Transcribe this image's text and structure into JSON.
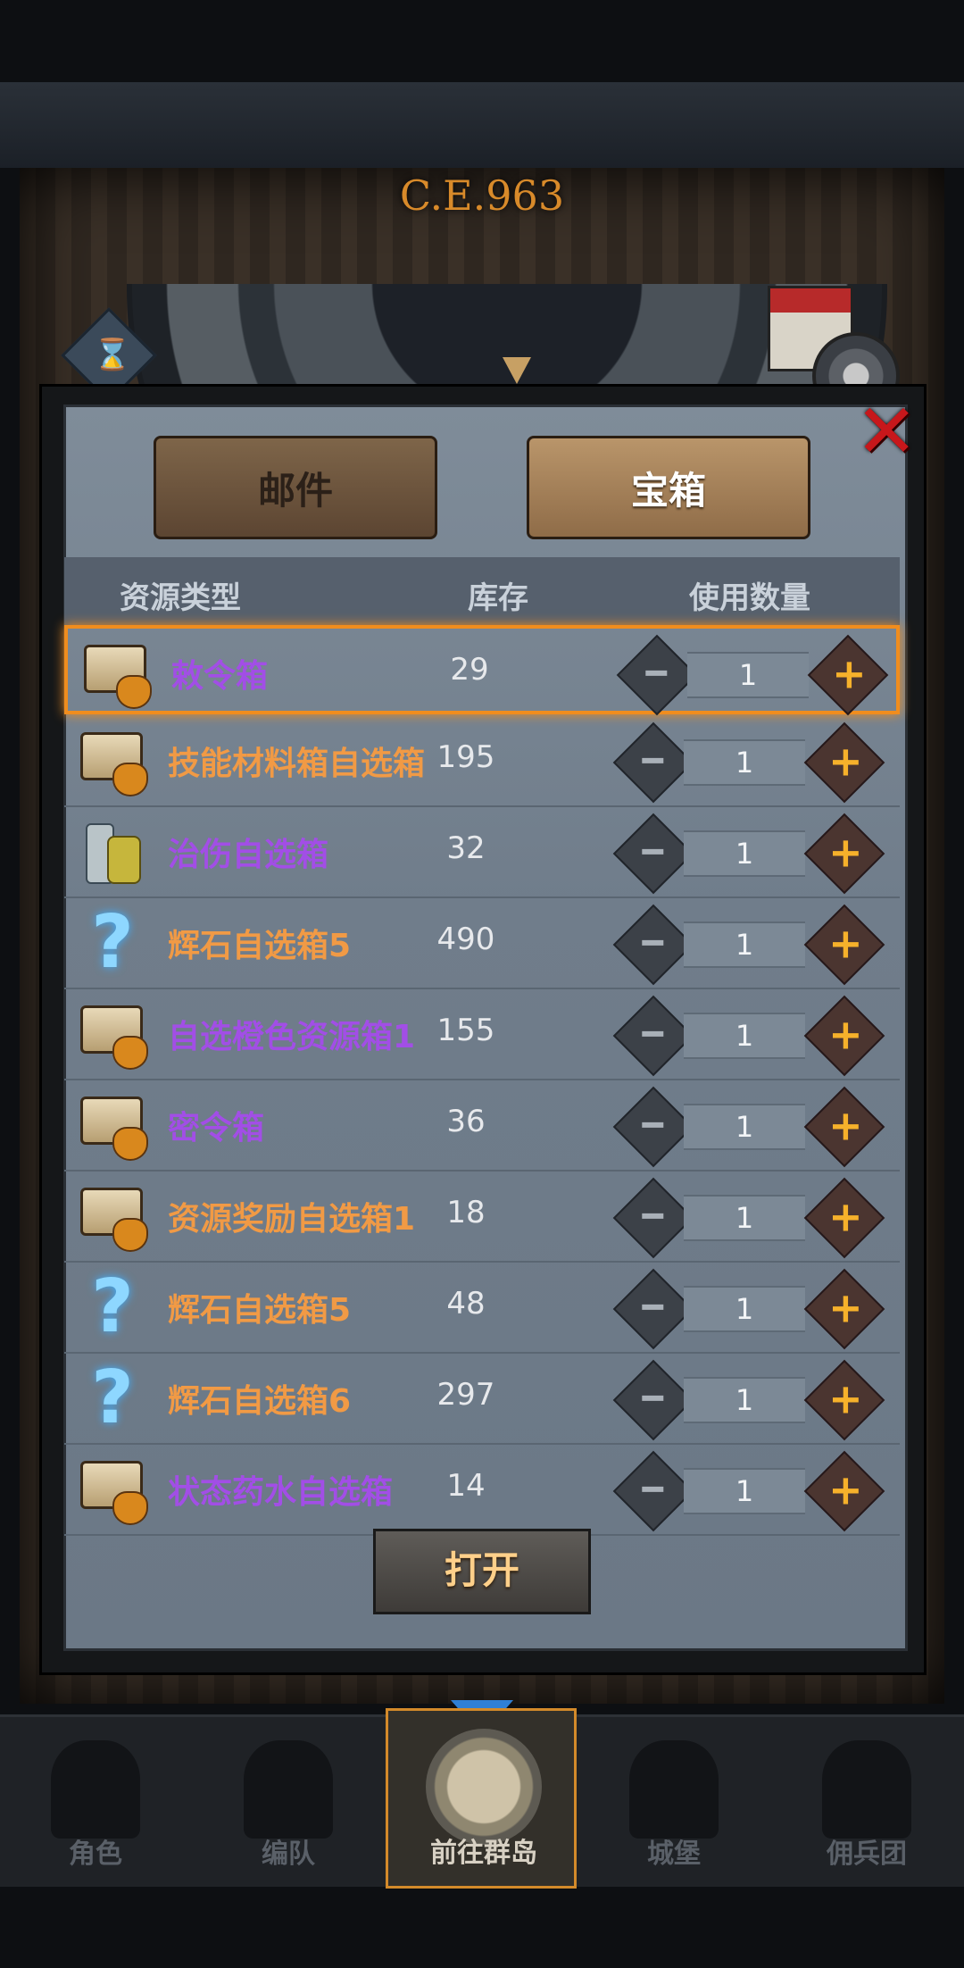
{
  "world": {
    "year": "C.E.963"
  },
  "tabs": {
    "mail": "邮件",
    "chest": "宝箱"
  },
  "header": {
    "type": "资源类型",
    "stock": "库存",
    "use": "使用数量"
  },
  "items": [
    {
      "name": "敕令箱",
      "stock": "29",
      "count": "1",
      "icon": "chest-icon",
      "color": "#a24ee6"
    },
    {
      "name": "技能材料箱自选箱",
      "stock": "195",
      "count": "1",
      "icon": "chest-icon",
      "color": "#f19a45"
    },
    {
      "name": "治伤自选箱",
      "stock": "32",
      "count": "1",
      "icon": "potion-icon",
      "color": "#a24ee6"
    },
    {
      "name": "辉石自选箱5",
      "stock": "490",
      "count": "1",
      "icon": "question-icon",
      "color": "#f19a45"
    },
    {
      "name": "自选橙色资源箱1",
      "stock": "155",
      "count": "1",
      "icon": "chest-icon",
      "color": "#a24ee6"
    },
    {
      "name": "密令箱",
      "stock": "36",
      "count": "1",
      "icon": "chest-icon",
      "color": "#a24ee6"
    },
    {
      "name": "资源奖励自选箱1",
      "stock": "18",
      "count": "1",
      "icon": "chest-icon",
      "color": "#f19a45"
    },
    {
      "name": "辉石自选箱5",
      "stock": "48",
      "count": "1",
      "icon": "question-icon",
      "color": "#f19a45"
    },
    {
      "name": "辉石自选箱6",
      "stock": "297",
      "count": "1",
      "icon": "question-icon",
      "color": "#f19a45"
    },
    {
      "name": "状态药水自选箱",
      "stock": "14",
      "count": "1",
      "icon": "chest-icon",
      "color": "#a24ee6"
    }
  ],
  "actions": {
    "open": "打开"
  },
  "nav": [
    {
      "label": "角色",
      "active": false
    },
    {
      "label": "编队",
      "active": false
    },
    {
      "label": "前往群岛",
      "active": true
    },
    {
      "label": "城堡",
      "active": false
    },
    {
      "label": "佣兵团",
      "active": false
    }
  ],
  "colors": {
    "highlight": "#f08d1e",
    "accent": "#f6b12b",
    "close": "#c7171b"
  }
}
